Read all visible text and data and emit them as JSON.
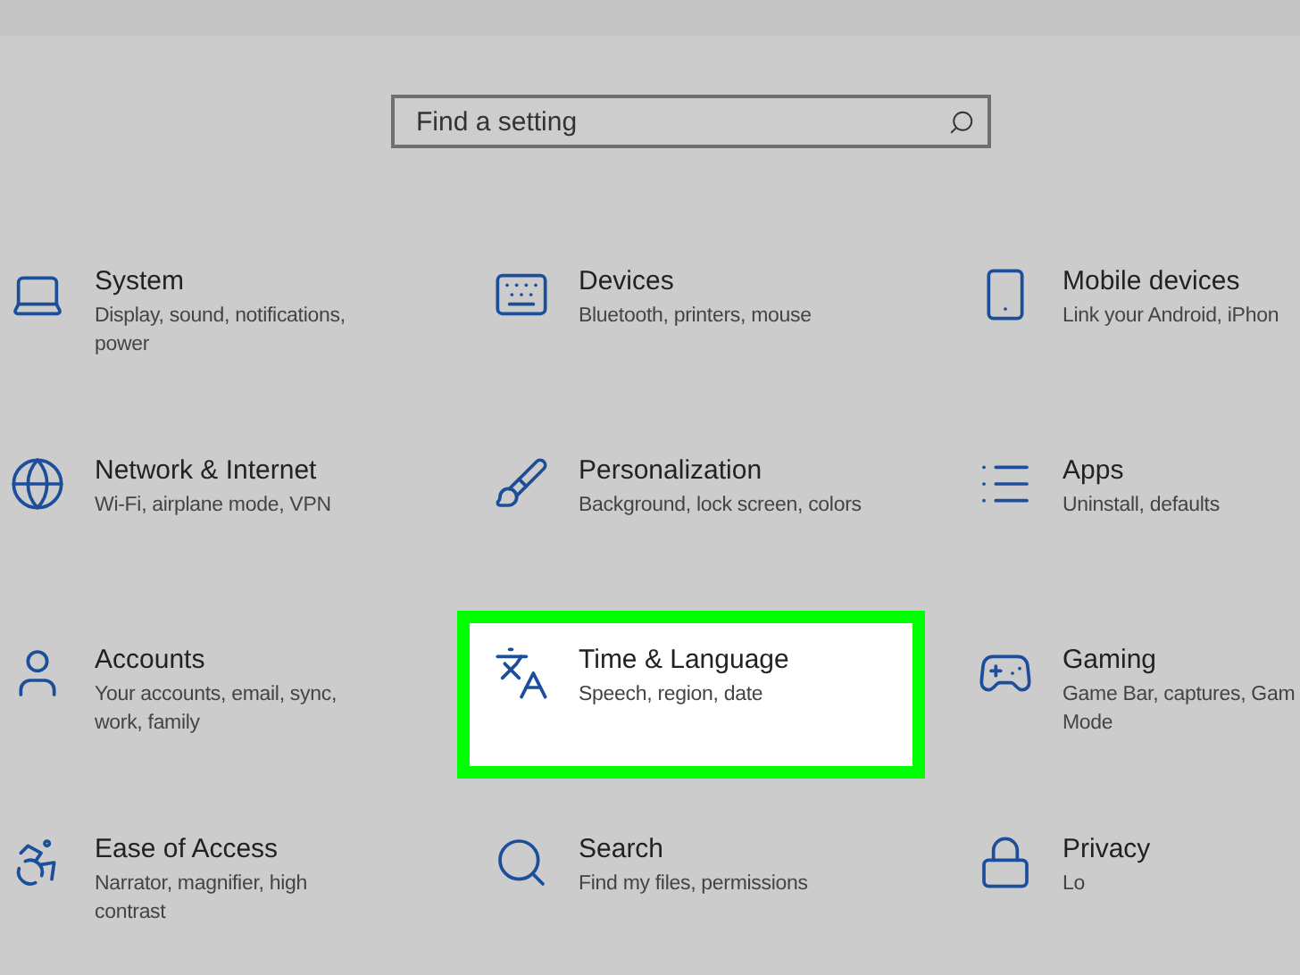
{
  "search": {
    "placeholder": "Find a setting"
  },
  "categories": [
    {
      "title": "System",
      "description": "Display, sound, notifications,\npower",
      "selected": false
    },
    {
      "title": "Devices",
      "description": "Bluetooth, printers, mouse",
      "selected": false
    },
    {
      "title": "Mobile devices",
      "description": "Link your Android, iPhon",
      "selected": false
    },
    {
      "title": "Network & Internet",
      "description": "Wi-Fi, airplane mode, VPN",
      "selected": false
    },
    {
      "title": "Personalization",
      "description": "Background, lock screen, colors",
      "selected": false
    },
    {
      "title": "Apps",
      "description": "Uninstall, defaults",
      "selected": false
    },
    {
      "title": "Accounts",
      "description": "Your accounts, email, sync,\nwork, family",
      "selected": false
    },
    {
      "title": "Time & Language",
      "description": "Speech, region, date",
      "selected": true
    },
    {
      "title": "Gaming",
      "description": "Game Bar, captures, Gam\nMode",
      "selected": false
    },
    {
      "title": "Ease of Access",
      "description": "Narrator, magnifier, high\ncontrast",
      "selected": false
    },
    {
      "title": "Search",
      "description": "Find my files, permissions",
      "selected": false
    },
    {
      "title": "Privacy",
      "description": "Lo",
      "selected": false
    }
  ]
}
